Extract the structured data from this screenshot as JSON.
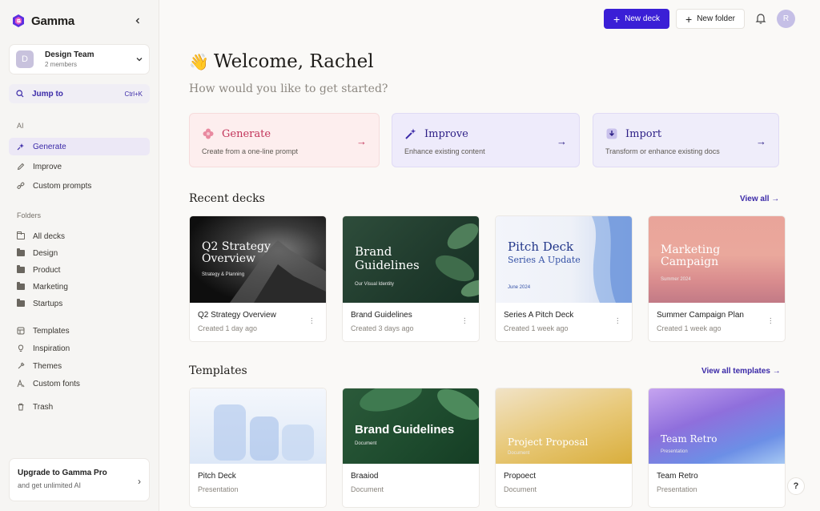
{
  "app": {
    "name": "Gamma"
  },
  "team": {
    "initial": "D",
    "name": "Design Team",
    "members": "2 members"
  },
  "jump": {
    "label": "Jump to",
    "shortcut": "Ctrl+K"
  },
  "sidebar": {
    "ai_label": "AI",
    "ai_items": [
      {
        "label": "Generate",
        "icon": "sparkle-icon"
      },
      {
        "label": "Improve",
        "icon": "pencil-icon"
      },
      {
        "label": "Custom prompts",
        "icon": "link-icon"
      }
    ],
    "folders_label": "Folders",
    "folders": [
      "All decks",
      "Design",
      "Product",
      "Marketing",
      "Startups"
    ],
    "other_items": [
      {
        "label": "Templates",
        "icon": "templates-icon"
      },
      {
        "label": "Inspiration",
        "icon": "lightbulb-icon"
      },
      {
        "label": "Themes",
        "icon": "palette-icon"
      },
      {
        "label": "Custom fonts",
        "icon": "font-icon"
      },
      {
        "label": "Trash",
        "icon": "trash-icon"
      }
    ],
    "upgrade": {
      "title": "Upgrade to Gamma Pro",
      "subtitle": "and get unlimited AI"
    }
  },
  "topbar": {
    "new_deck": "New deck",
    "new_folder": "New folder",
    "user_initial": "R"
  },
  "welcome": {
    "emoji": "👋",
    "title": "Welcome, Rachel",
    "subtitle": "How would you like to get started?"
  },
  "actions": [
    {
      "title": "Generate",
      "desc": "Create from a one-line prompt"
    },
    {
      "title": "Improve",
      "desc": "Enhance existing content"
    },
    {
      "title": "Import",
      "desc": "Transform or enhance existing docs"
    }
  ],
  "recent": {
    "title": "Recent decks",
    "view_all": "View all",
    "decks": [
      {
        "thumb_title": "Q2 Strategy\nOverview",
        "thumb_sub": "Strategy & Planning",
        "name": "Q2 Strategy Overview",
        "meta": "Created 1 day ago"
      },
      {
        "thumb_title": "Brand\nGuidelines",
        "thumb_sub": "Our Visual Identity",
        "name": "Brand Guidelines",
        "meta": "Created 3 days ago"
      },
      {
        "thumb_title": "Pitch Deck",
        "thumb_title2": "Series A Update",
        "thumb_sub": "June 2024",
        "name": "Series A Pitch Deck",
        "meta": "Created 1 week ago"
      },
      {
        "thumb_title": "Marketing\nCampaign",
        "thumb_sub": "Summer 2024",
        "name": "Summer Campaign Plan",
        "meta": "Created 1 week ago"
      }
    ]
  },
  "templates": {
    "title": "Templates",
    "view_all": "View all templates",
    "items": [
      {
        "thumb_title": "",
        "thumb_sub": "",
        "name": "Pitch Deck",
        "meta": "Presentation"
      },
      {
        "thumb_title": "Brand Guidelines",
        "thumb_sub": "Document",
        "name": "Braaiod",
        "meta": "Document"
      },
      {
        "thumb_title": "Project Proposal",
        "thumb_sub": "Document",
        "name": "Propoect",
        "meta": "Document"
      },
      {
        "thumb_title": "Team Retro",
        "thumb_sub": "Presentation",
        "name": "Team Retro",
        "meta": "Presentation"
      }
    ]
  },
  "help": {
    "label": "?"
  },
  "colors": {
    "accent": "#3a1fd6",
    "generate_bg": "#fdeeee",
    "improve_bg": "#eeebfb",
    "import_bg": "#efedfa"
  }
}
